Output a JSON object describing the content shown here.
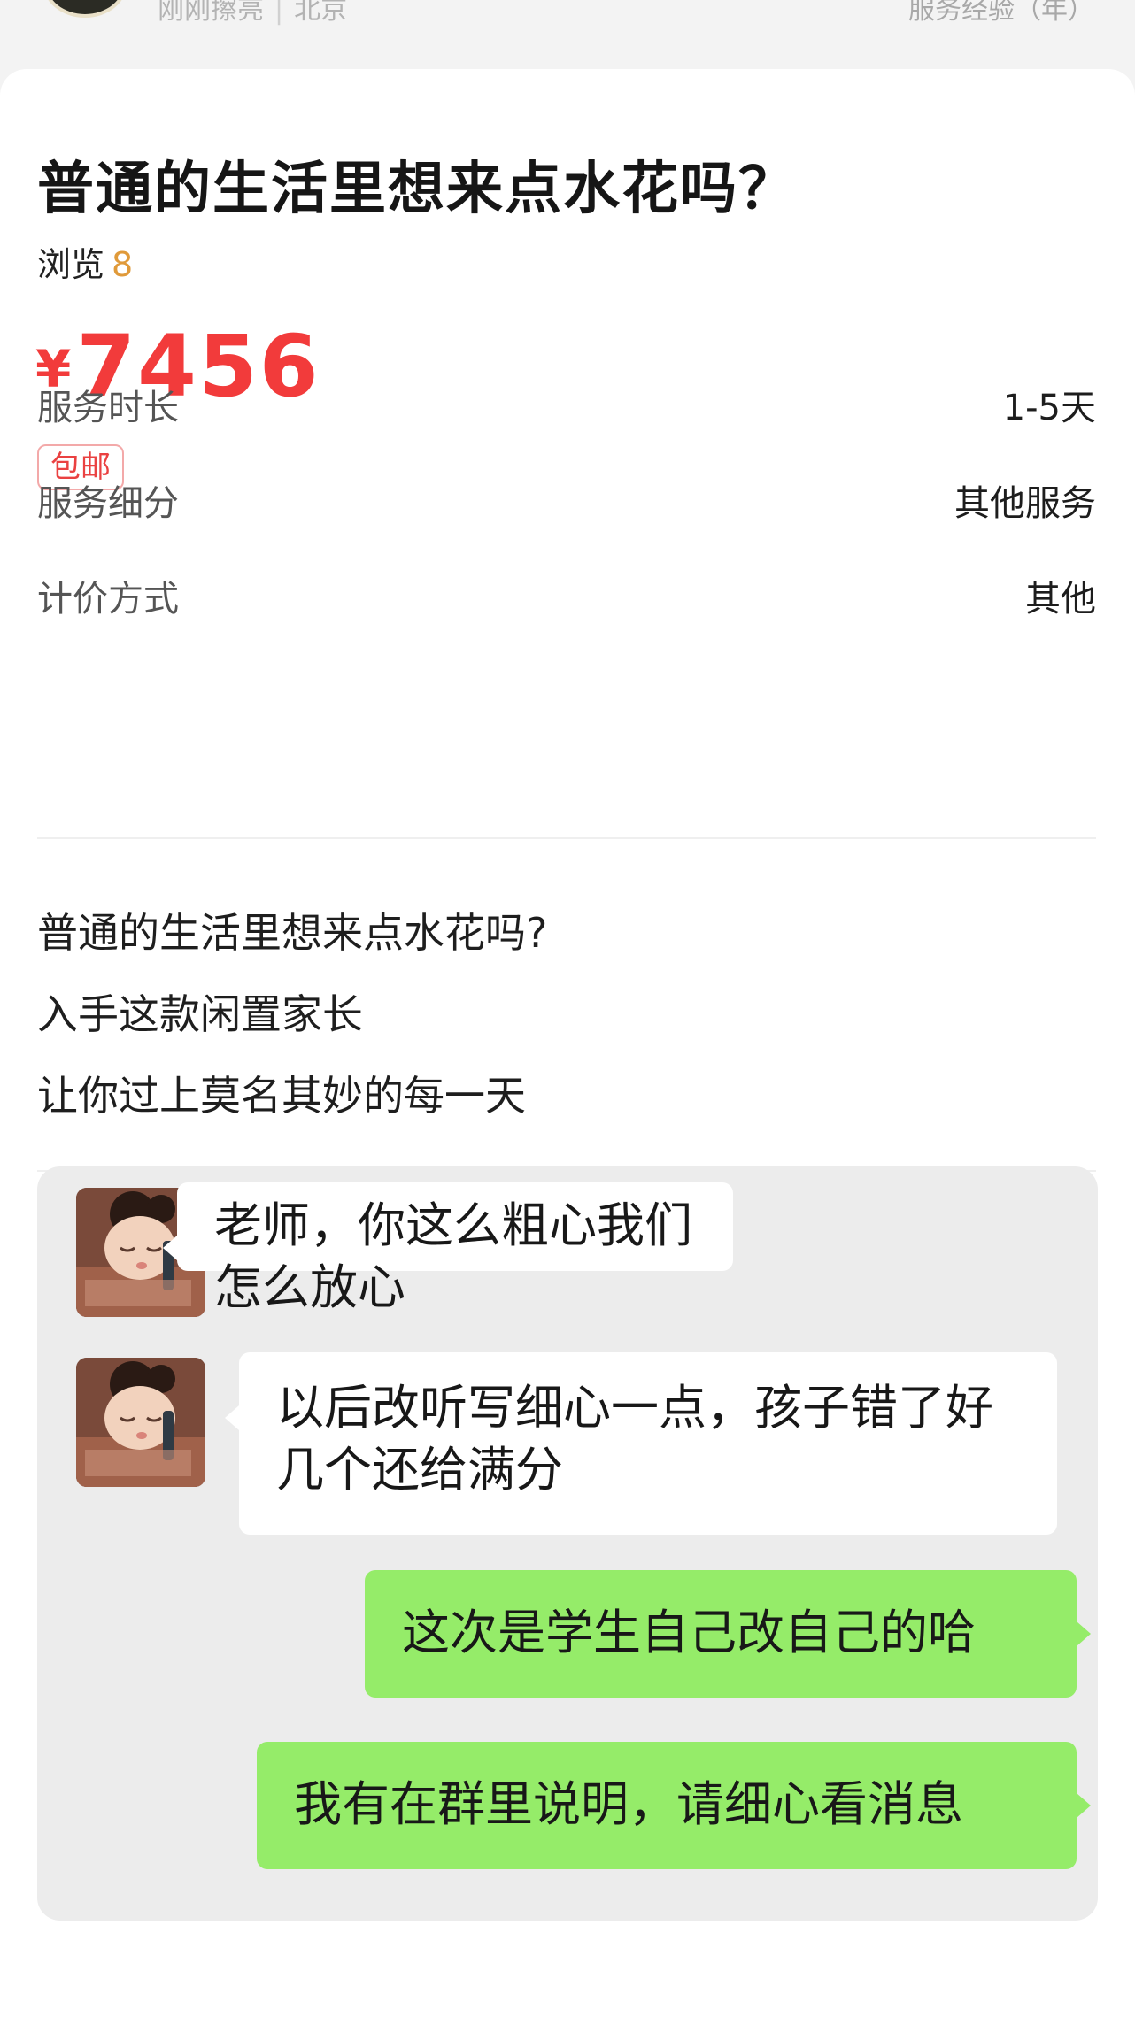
{
  "seller": {
    "status": "刚刚擦亮",
    "location": "北京",
    "service_experience_label": "服务经验（年）"
  },
  "listing": {
    "title": "普通的生活里想来点水花吗？",
    "views_label": "浏览",
    "views_count": "8",
    "price_symbol": "¥",
    "price": "7456",
    "shipping_tag": "包邮"
  },
  "attributes": [
    {
      "key": "服务时长",
      "value": "1-5天"
    },
    {
      "key": "服务细分",
      "value": "其他服务"
    },
    {
      "key": "计价方式",
      "value": "其他"
    }
  ],
  "description": [
    "普通的生活里想来点水花吗?",
    "入手这款闲置家长",
    "让你过上莫名其妙的每一天"
  ],
  "chat": [
    {
      "side": "in",
      "text": "老师，你这么粗心我们怎么放心"
    },
    {
      "side": "in",
      "text": "以后改听写细心一点，孩子错了好几个还给满分"
    },
    {
      "side": "out",
      "text": "这次是学生自己改自己的哈"
    },
    {
      "side": "out",
      "text": "我有在群里说明，请细心看消息"
    }
  ],
  "colors": {
    "price": "#f23b3b",
    "views_count": "#e09a3a",
    "outgoing_bubble": "#95ec69",
    "incoming_bubble": "#ffffff",
    "chat_background": "#ececec"
  }
}
